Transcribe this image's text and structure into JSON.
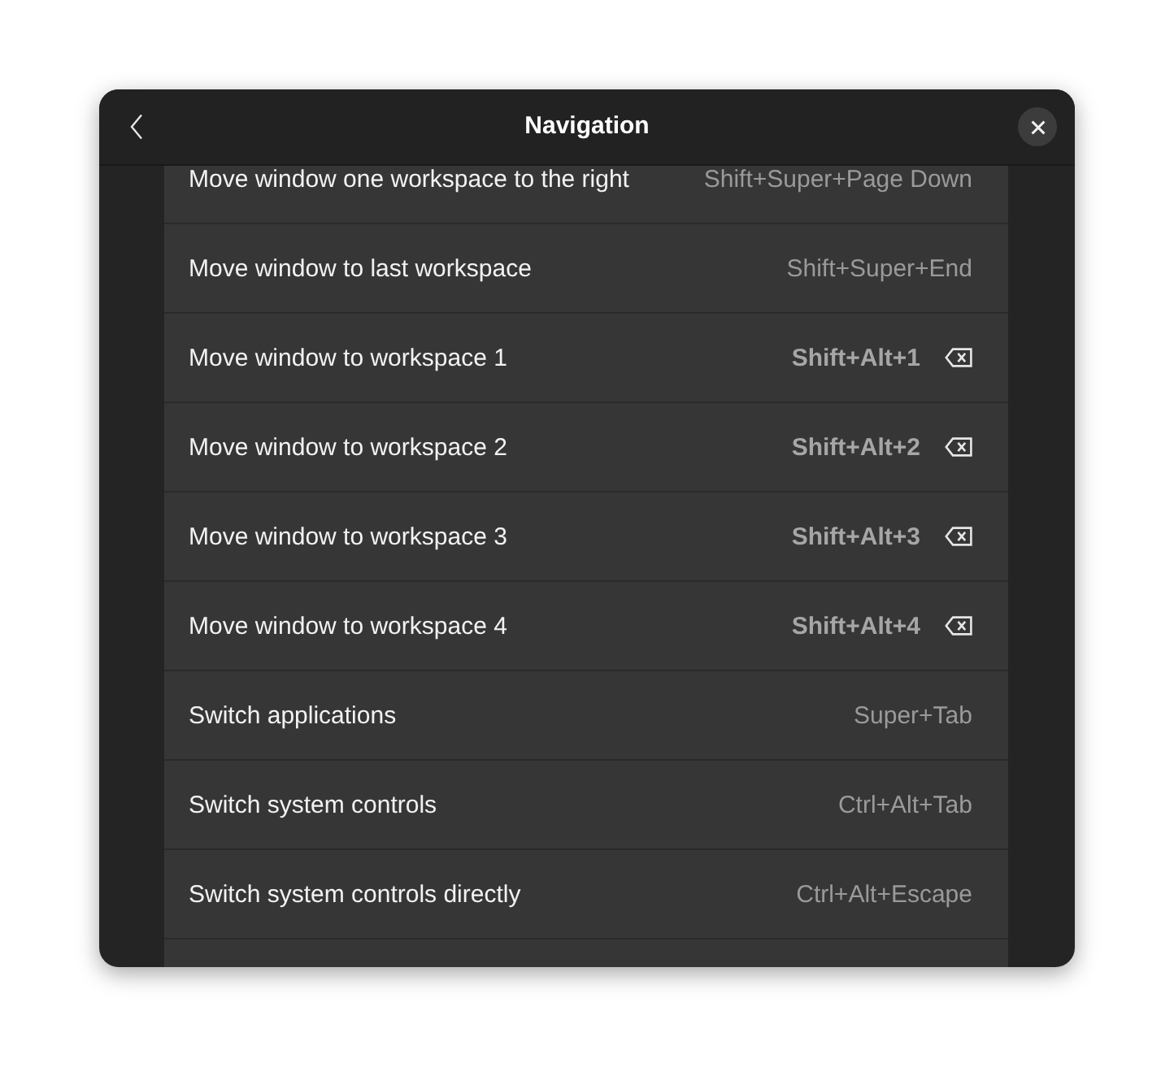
{
  "window": {
    "title": "Navigation"
  },
  "shortcuts": [
    {
      "name": "Move window one workspace to the right",
      "accelerator": "Shift+Super+Page Down",
      "custom": false
    },
    {
      "name": "Move window to last workspace",
      "accelerator": "Shift+Super+End",
      "custom": false
    },
    {
      "name": "Move window to workspace 1",
      "accelerator": "Shift+Alt+1",
      "custom": true
    },
    {
      "name": "Move window to workspace 2",
      "accelerator": "Shift+Alt+2",
      "custom": true
    },
    {
      "name": "Move window to workspace 3",
      "accelerator": "Shift+Alt+3",
      "custom": true
    },
    {
      "name": "Move window to workspace 4",
      "accelerator": "Shift+Alt+4",
      "custom": true
    },
    {
      "name": "Switch applications",
      "accelerator": "Super+Tab",
      "custom": false
    },
    {
      "name": "Switch system controls",
      "accelerator": "Ctrl+Alt+Tab",
      "custom": false
    },
    {
      "name": "Switch system controls directly",
      "accelerator": "Ctrl+Alt+Escape",
      "custom": false
    }
  ]
}
